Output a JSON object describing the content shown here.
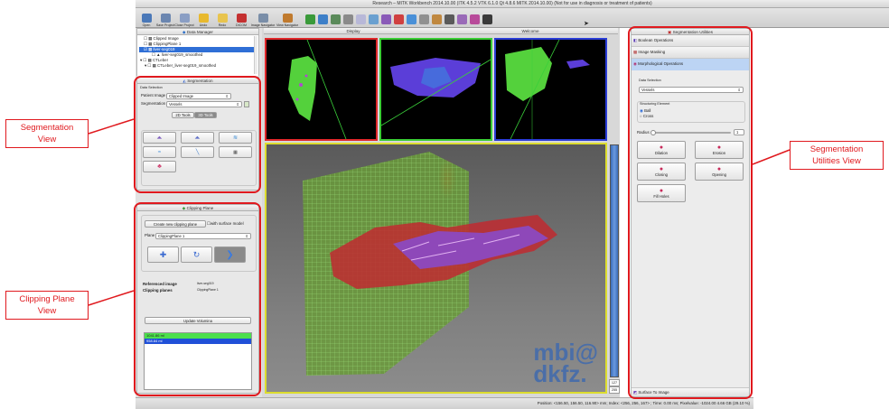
{
  "window": {
    "title": "Research – MITK Workbench 2014.10.00 (ITK 4.5.2  VTK 6.1.0 Qt 4.8.6 MITK 2014.10.00) (Not for use in diagnosis or treatment of patients)"
  },
  "toolbar": {
    "items": [
      "Open",
      "Save Project",
      "Close Project",
      "Undo",
      "Redo",
      "DICOM",
      "Image Navigator",
      "View Navigator"
    ]
  },
  "data_manager": {
    "title": "Data Manager",
    "nodes": [
      "Clipped Image",
      "ClippingPlane 1",
      "liver-seg019",
      "liver-seg019_smoothed",
      "CTLeber",
      "CTLeber_liver-seg019_smoothed"
    ]
  },
  "segmentation": {
    "title": "Segmentation",
    "data_selection": "Data Selection",
    "patient_image_label": "Patient Image",
    "patient_image_value": "Clipped Image",
    "segmentation_label": "Segmentation",
    "segmentation_value": "Vessels",
    "tab_2d": "2D Tools",
    "tab_3d": "3D Tools"
  },
  "clipping": {
    "title": "Clipping Plane",
    "create_button": "Create new clipping plane",
    "surface_model": "with surface model",
    "plane_label": "Plane",
    "plane_value": "ClippingPlane 1",
    "referenced_label": "Referenced image",
    "referenced_value": "liver-seg019",
    "planes_label": "Clipping planes",
    "planes_value": "ClippingPlane 1",
    "update_button": "Update Volumina",
    "volumes": [
      "1041.86 ml",
      "958.84 ml"
    ]
  },
  "display": {
    "tab_display": "Display",
    "tab_welcome": "Welcome",
    "slider_value1": "127",
    "slider_value2": "255",
    "logo_line1": "mbi@",
    "logo_line2": "dkfz."
  },
  "utilities": {
    "title": "Segmentation Utilities",
    "boolean": "Boolean Operations",
    "masking": "Image Masking",
    "morphological": "Morphological Operations",
    "data_selection": "Data Selection",
    "data_value": "Vessels",
    "structuring": "Structuring Element",
    "ball": "Ball",
    "cross": "Cross",
    "radius_label": "Radius",
    "radius_value": "1",
    "dilation": "Dilation",
    "erosion": "Erosion",
    "closing": "Closing",
    "opening": "Opening",
    "fill_holes": "Fill Holes",
    "surface_to_image": "Surface To Image"
  },
  "status": {
    "text": "Position: <156.50, 156.50, 116.90> mm; Index: <256, 256, 167> ; Time: 0.00 ms; Pixelvalue: -1024.00   4.66 GB (29.10 %)"
  },
  "callouts": {
    "segmentation_view": [
      "Segmentation",
      "View"
    ],
    "clipping_view": [
      "Clipping Plane",
      "View"
    ],
    "utilities_view": [
      "Segmentation",
      "Utilities View"
    ]
  }
}
